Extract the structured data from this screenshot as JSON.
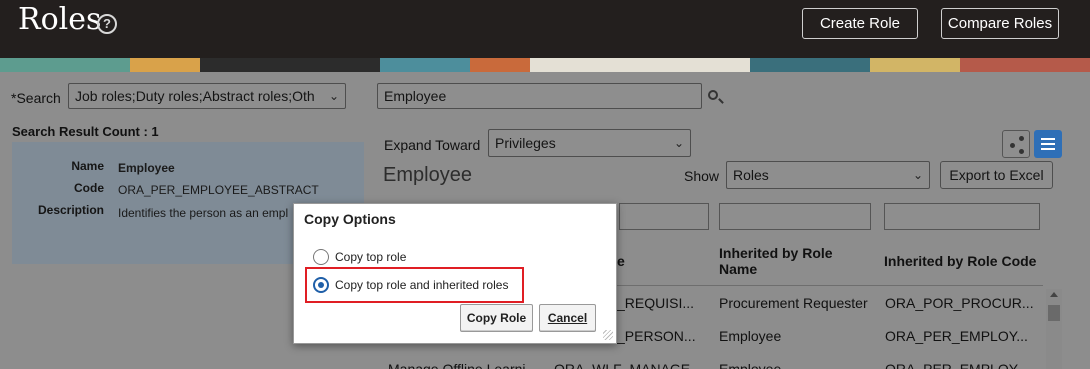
{
  "header": {
    "title": "Roles",
    "create_role": "Create Role",
    "compare_roles": "Compare Roles"
  },
  "search": {
    "label": "*Search",
    "scope_value": "Job roles;Duty roles;Abstract roles;Oth",
    "query_value": "Employee",
    "result_count": "Search Result Count : 1"
  },
  "detail": {
    "name_label": "Name",
    "name_value": "Employee",
    "code_label": "Code",
    "code_value": "ORA_PER_EMPLOYEE_ABSTRACT",
    "description_label": "Description",
    "description_value": "Identifies the person as an empl"
  },
  "viewer": {
    "expand_label": "Expand Toward",
    "expand_value": "Privileges",
    "role_heading": "Employee",
    "show_label": "Show",
    "show_value": "Roles",
    "export_label": "Export to Excel",
    "columns": {
      "col2_partial": "e",
      "inherited_name": "Inherited by Role Name",
      "inherited_code": "Inherited by Role Code"
    },
    "rows": [
      {
        "c1": "",
        "c2": "_REQUISI...",
        "name": "Procurement Requester",
        "code": "ORA_POR_PROCUR..."
      },
      {
        "c1": "",
        "c2": "_PERSON...",
        "name": "Employee",
        "code": "ORA_PER_EMPLOY..."
      },
      {
        "c1": "Manage Offline Learni...",
        "c2": "ORA_WLF_MANAGE...",
        "name": "Employee",
        "code": "ORA_PER_EMPLOY..."
      }
    ]
  },
  "dialog": {
    "title": "Copy Options",
    "option1": "Copy top role",
    "option2": "Copy top role and inherited roles",
    "selected": "option2",
    "copy_button": "Copy Role",
    "cancel_button": "Cancel"
  },
  "colors": {
    "header_bg": "#231f1e",
    "highlight": "#e01e24",
    "radio_selected": "#1f5fa8",
    "list_view_active": "#2e6fb7"
  }
}
